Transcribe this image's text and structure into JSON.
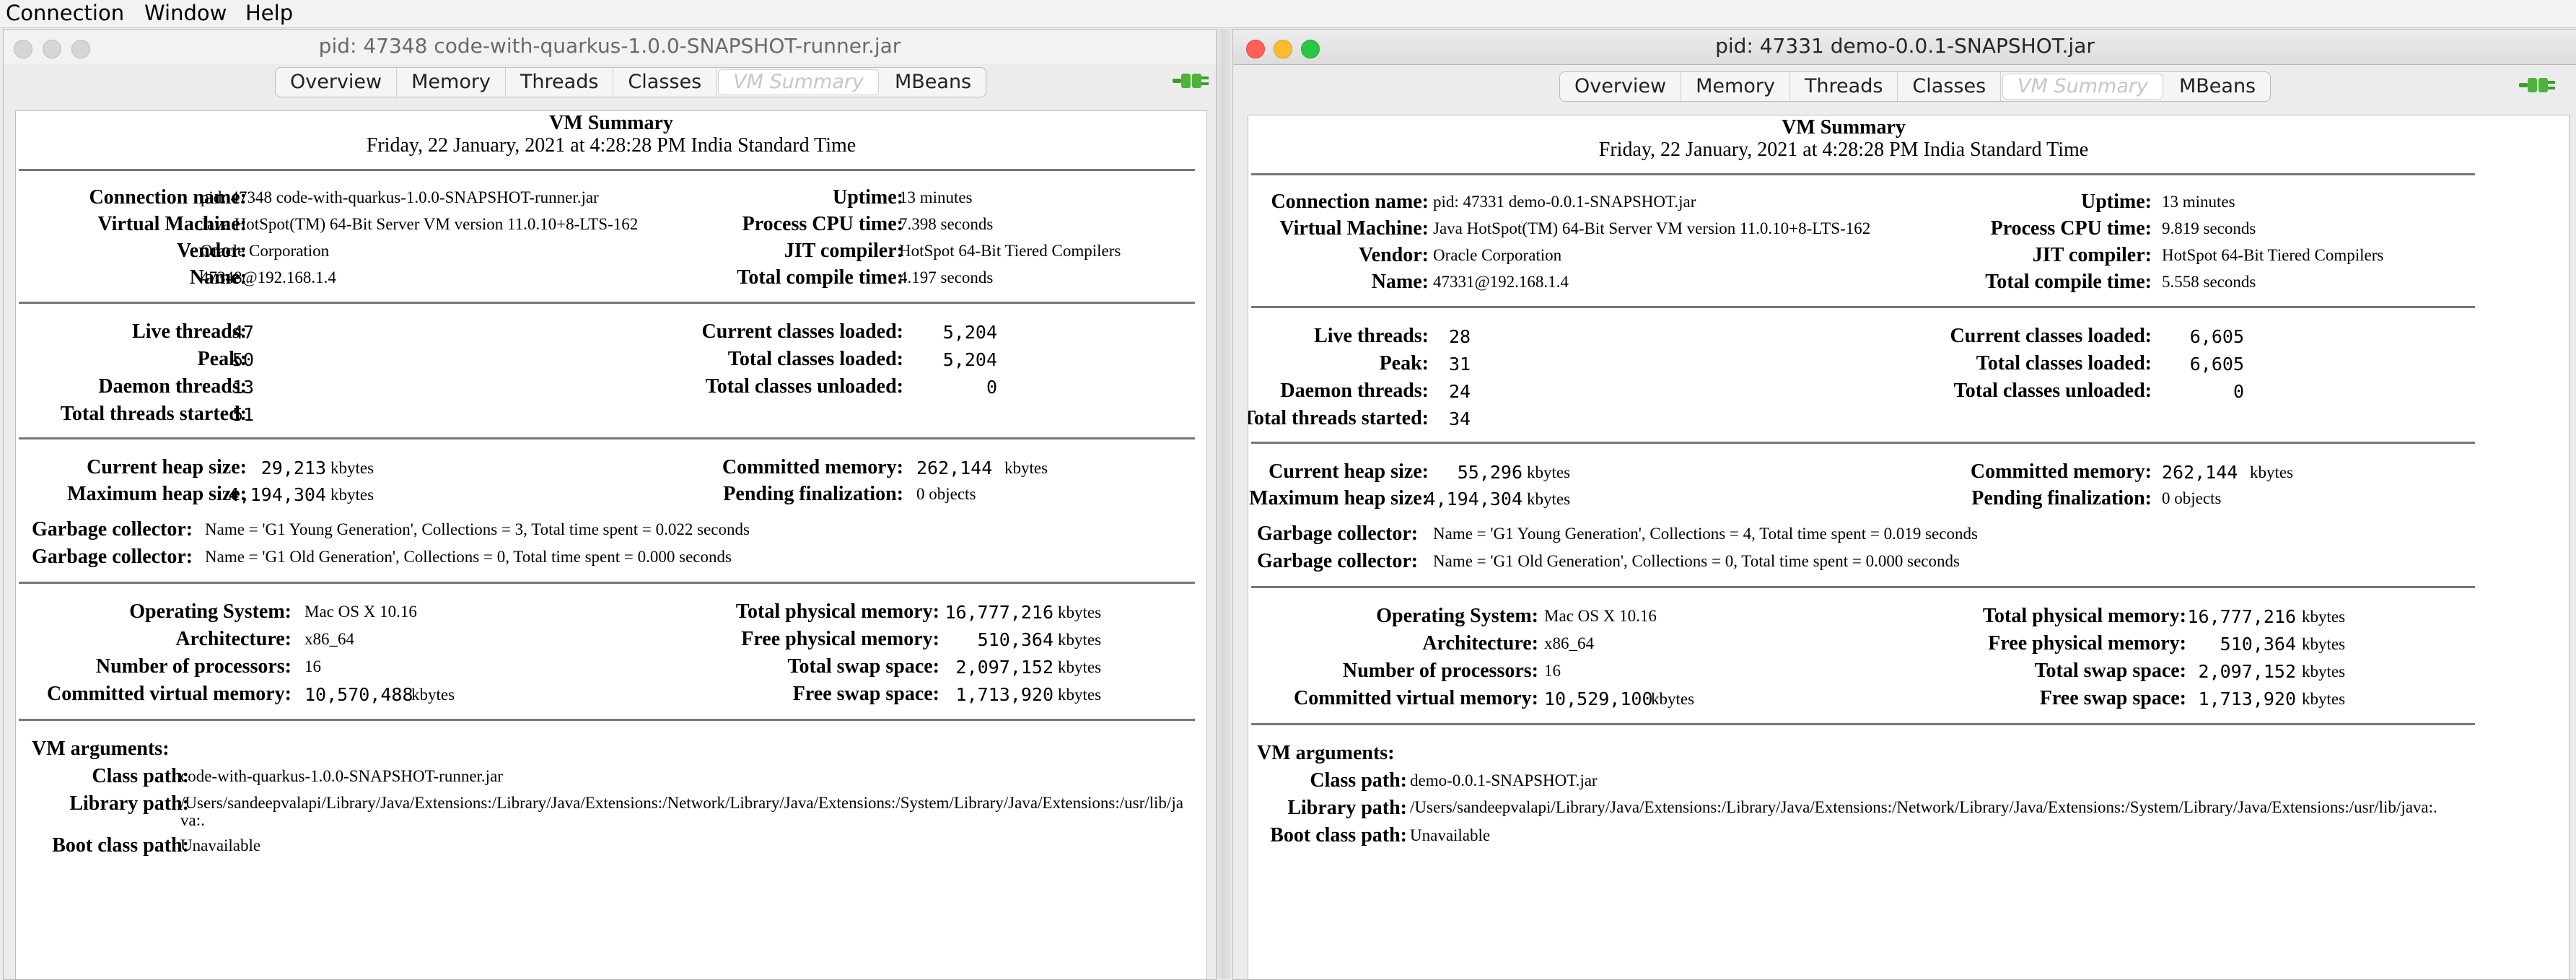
{
  "menu": [
    "Connection",
    "Window",
    "Help"
  ],
  "tabs": [
    "Overview",
    "Memory",
    "Threads",
    "Classes",
    "VM Summary",
    "MBeans"
  ],
  "active_tab": "VM Summary",
  "colors": {
    "window_bg": "#ececec",
    "content_bg": "#ffffff",
    "close": "#fe5f57",
    "minimize": "#febc2e",
    "zoom": "#28c840",
    "plug_icon": "#3f9b2c"
  },
  "icons": {
    "connection_status": "plug-connected-icon"
  },
  "labels": {
    "vm_summary": "VM Summary",
    "connection_name": "Connection name:",
    "virtual_machine": "Virtual Machine:",
    "vendor": "Vendor:",
    "name": "Name:",
    "uptime": "Uptime:",
    "process_cpu_time": "Process CPU time:",
    "jit_compiler": "JIT compiler:",
    "total_compile_time": "Total compile time:",
    "live_threads": "Live threads:",
    "peak": "Peak:",
    "daemon_threads": "Daemon threads:",
    "total_threads_started": "Total threads started:",
    "current_classes_loaded": "Current classes loaded:",
    "total_classes_loaded": "Total classes loaded:",
    "total_classes_unloaded": "Total classes unloaded:",
    "current_heap_size": "Current heap size:",
    "maximum_heap_size": "Maximum heap size:",
    "committed_memory": "Committed memory:",
    "pending_finalization": "Pending finalization:",
    "garbage_collector": "Garbage collector:",
    "operating_system": "Operating System:",
    "architecture": "Architecture:",
    "number_of_processors": "Number of processors:",
    "committed_virtual_memory": "Committed virtual memory:",
    "total_physical_memory": "Total physical memory:",
    "free_physical_memory": "Free physical memory:",
    "total_swap_space": "Total swap space:",
    "free_swap_space": "Free swap space:",
    "vm_arguments": "VM arguments:",
    "class_path": "Class path:",
    "library_path": "Library path:",
    "boot_class_path": "Boot class path:",
    "kbytes": "kbytes"
  },
  "windows": [
    {
      "title": "pid: 47348 code-with-quarkus-1.0.0-SNAPSHOT-runner.jar",
      "date": "Friday, 22 January, 2021 at 4:28:28 PM India Standard Time",
      "connection_name": "pid: 47348 code-with-quarkus-1.0.0-SNAPSHOT-runner.jar",
      "virtual_machine": "Java HotSpot(TM) 64-Bit Server VM version 11.0.10+8-LTS-162",
      "vendor": "Oracle Corporation",
      "name": "47348@192.168.1.4",
      "uptime": "13 minutes",
      "process_cpu_time": "7.398 seconds",
      "jit_compiler": "HotSpot 64-Bit Tiered Compilers",
      "total_compile_time": "4.197 seconds",
      "live_threads": "47",
      "peak": "50",
      "daemon_threads": "13",
      "total_threads_started": "51",
      "current_classes_loaded": "5,204",
      "total_classes_loaded": "5,204",
      "total_classes_unloaded": "0",
      "current_heap_size": "29,213",
      "maximum_heap_size": "4,194,304",
      "committed_memory": "262,144",
      "pending_finalization": "0 objects",
      "gc_young": "Name = 'G1 Young Generation', Collections = 3, Total time spent = 0.022 seconds",
      "gc_old": "Name = 'G1 Old Generation', Collections = 0, Total time spent = 0.000 seconds",
      "operating_system": "Mac OS X 10.16",
      "architecture": "x86_64",
      "number_of_processors": "16",
      "committed_virtual_memory": "10,570,488",
      "total_physical_memory": "16,777,216",
      "free_physical_memory": "510,364",
      "total_swap_space": "2,097,152",
      "free_swap_space": "1,713,920",
      "class_path": "code-with-quarkus-1.0.0-SNAPSHOT-runner.jar",
      "library_path": "/Users/sandeepvalapi/Library/Java/Extensions:/Library/Java/Extensions:/Network/Library/Java/Extensions:/System/Library/Java/Extensions:/usr/lib/java:.",
      "boot_class_path": "Unavailable"
    },
    {
      "title": "pid: 47331 demo-0.0.1-SNAPSHOT.jar",
      "date": "Friday, 22 January, 2021 at 4:28:28 PM India Standard Time",
      "connection_name": "pid: 47331 demo-0.0.1-SNAPSHOT.jar",
      "virtual_machine": "Java HotSpot(TM) 64-Bit Server VM version 11.0.10+8-LTS-162",
      "vendor": "Oracle Corporation",
      "name": "47331@192.168.1.4",
      "uptime": "13 minutes",
      "process_cpu_time": "9.819 seconds",
      "jit_compiler": "HotSpot 64-Bit Tiered Compilers",
      "total_compile_time": "5.558 seconds",
      "live_threads": "28",
      "peak": "31",
      "daemon_threads": "24",
      "total_threads_started": "34",
      "current_classes_loaded": "6,605",
      "total_classes_loaded": "6,605",
      "total_classes_unloaded": "0",
      "current_heap_size": "55,296",
      "maximum_heap_size": "4,194,304",
      "committed_memory": "262,144",
      "pending_finalization": "0 objects",
      "gc_young": "Name = 'G1 Young Generation', Collections = 4, Total time spent = 0.019 seconds",
      "gc_old": "Name = 'G1 Old Generation', Collections = 0, Total time spent = 0.000 seconds",
      "operating_system": "Mac OS X 10.16",
      "architecture": "x86_64",
      "number_of_processors": "16",
      "committed_virtual_memory": "10,529,100",
      "total_physical_memory": "16,777,216",
      "free_physical_memory": "510,364",
      "total_swap_space": "2,097,152",
      "free_swap_space": "1,713,920",
      "class_path": "demo-0.0.1-SNAPSHOT.jar",
      "library_path": "/Users/sandeepvalapi/Library/Java/Extensions:/Library/Java/Extensions:/Network/Library/Java/Extensions:/System/Library/Java/Extensions:/usr/lib/java:.",
      "boot_class_path": "Unavailable"
    }
  ]
}
